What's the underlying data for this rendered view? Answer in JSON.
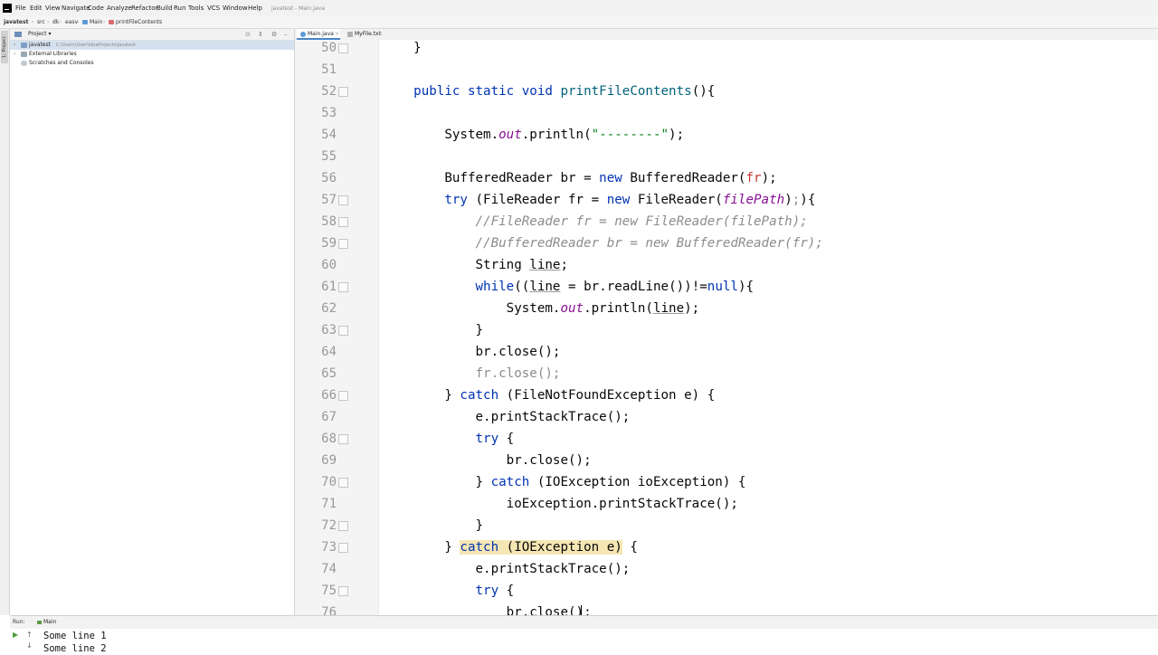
{
  "window": {
    "title": "javatest - Main.java"
  },
  "menu": [
    "File",
    "Edit",
    "View",
    "Navigate",
    "Code",
    "Analyze",
    "Refactor",
    "Build",
    "Run",
    "Tools",
    "VCS",
    "Window",
    "Help"
  ],
  "breadcrumb": [
    "javatest",
    "src",
    "dk",
    "easv",
    "Main",
    "printFileContents"
  ],
  "project_panel": {
    "title": "Project",
    "project_name": "javatest",
    "project_path": "C:\\Users\\User\\IdeaProjects\\javatest",
    "items": [
      "External Libraries",
      "Scratches and Consoles"
    ]
  },
  "left_strip": {
    "project_tab": "1: Project"
  },
  "editor": {
    "tabs": [
      {
        "label": "Main.java",
        "active": true
      },
      {
        "label": "MyFile.txt",
        "active": false
      }
    ],
    "line_numbers": [
      "50",
      "51",
      "52",
      "53",
      "54",
      "55",
      "56",
      "57",
      "58",
      "59",
      "60",
      "61",
      "62",
      "63",
      "64",
      "65",
      "66",
      "67",
      "68",
      "69",
      "70",
      "71",
      "72",
      "73",
      "74",
      "75",
      "76"
    ]
  },
  "run_panel": {
    "label": "Run:",
    "tab": "Main",
    "output": [
      "Some line 1",
      "Some line 2"
    ]
  },
  "colors": {
    "keyword": "#0033b3",
    "string": "#067d17",
    "field": "#871094",
    "comment": "#8c8c8c",
    "highlight": "#f5e6b4",
    "selection": "#d5e1ef"
  }
}
